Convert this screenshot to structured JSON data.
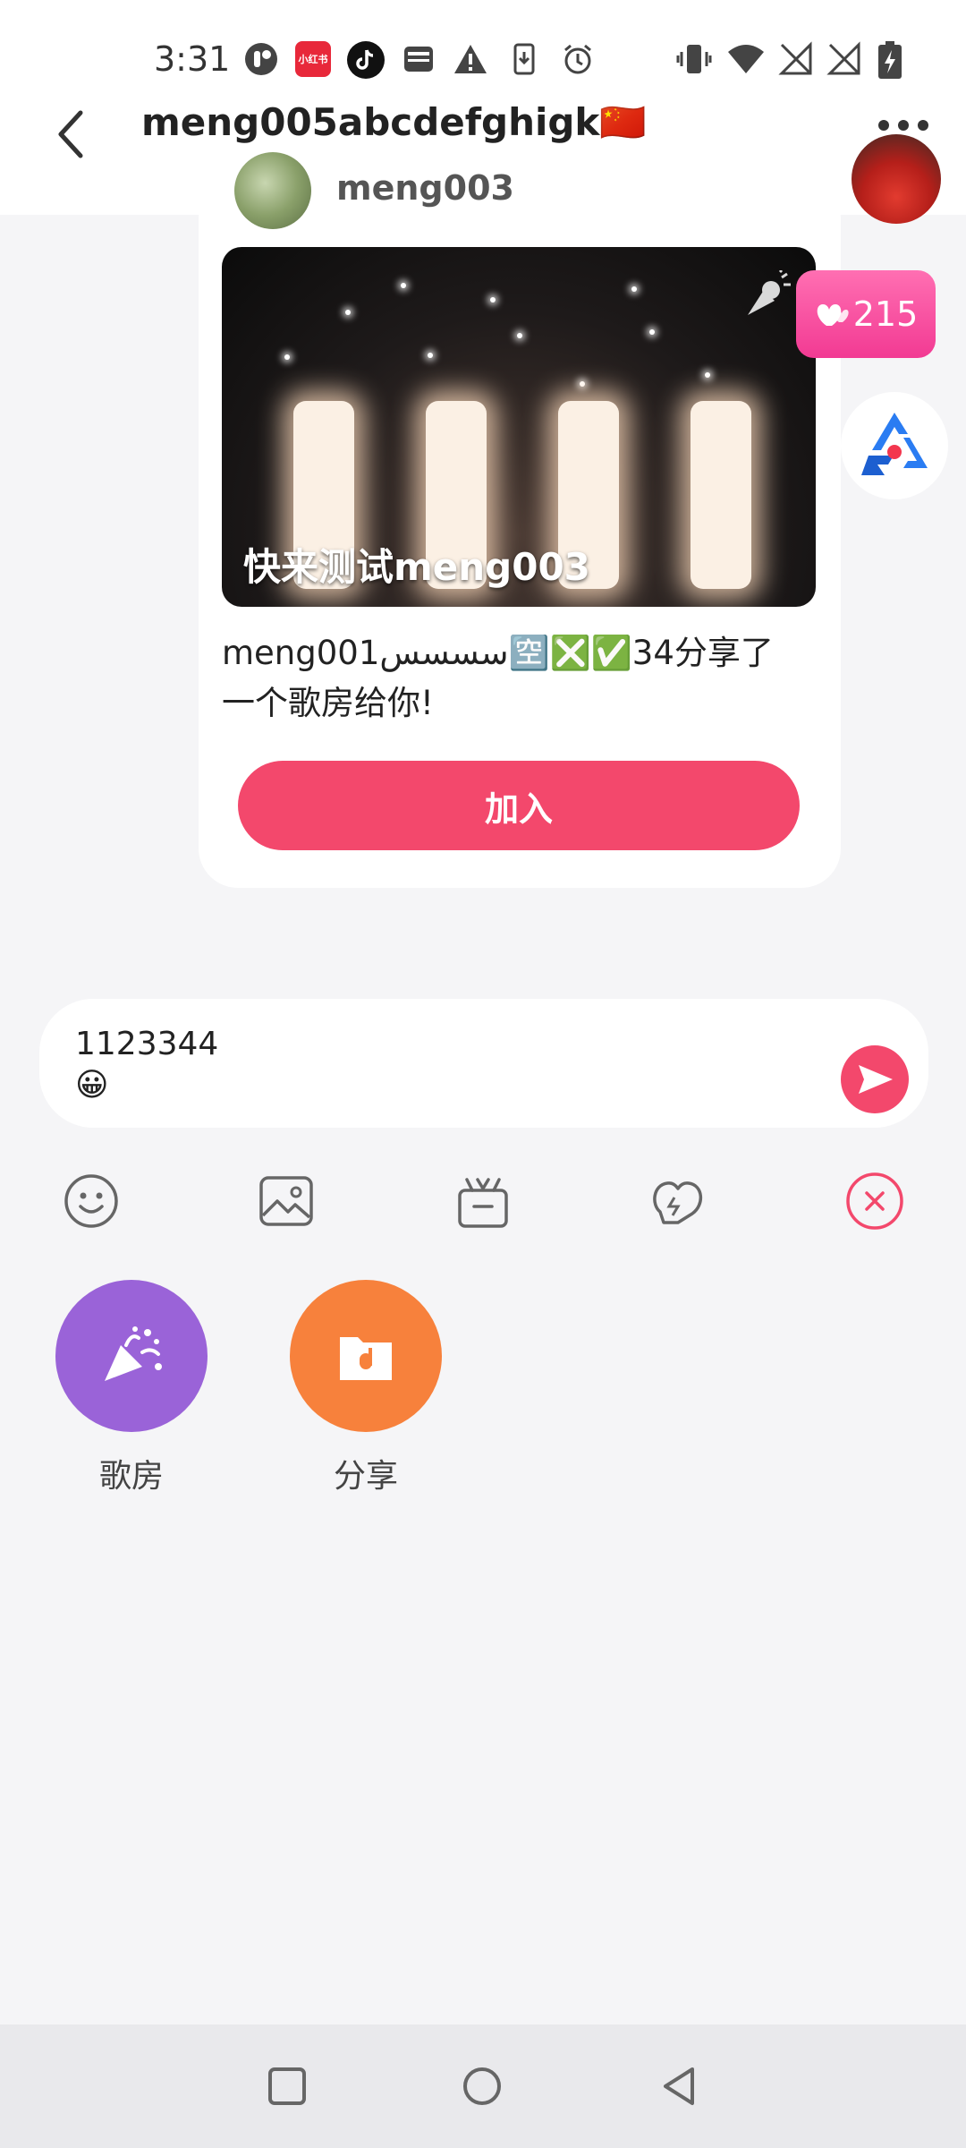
{
  "status_bar": {
    "time": "3:31",
    "app_icons": [
      "pill-icon",
      "xiaohongshu-icon",
      "tiktok-icon",
      "wallet-icon",
      "warning-icon",
      "download-icon",
      "alarm-icon"
    ],
    "system_icons": [
      "vibrate-icon",
      "wifi-icon",
      "no-signal-icon",
      "no-signal-icon",
      "battery-charging-icon"
    ],
    "xiaohongshu_label": "小红书"
  },
  "header": {
    "title": "meng005abcdefghigk🇨🇳"
  },
  "message_card": {
    "sender_name": "meng003",
    "room_title": "快来测试meng003",
    "share_text": "meng001سسسس🈳❎✅34分享了一个歌房给你!",
    "join_label": "加入"
  },
  "floating": {
    "heart_count": "215"
  },
  "input": {
    "text": "1123344\n😀"
  },
  "toolbar": {
    "items": [
      "emoji-icon",
      "image-icon",
      "gift-icon",
      "heart-chat-icon",
      "close-icon"
    ]
  },
  "features": [
    {
      "label": "歌房",
      "color": "#9a63d8"
    },
    {
      "label": "分享",
      "color": "#f7813c"
    }
  ],
  "colors": {
    "accent": "#f3486c",
    "badge_pink": "#f23a93"
  }
}
